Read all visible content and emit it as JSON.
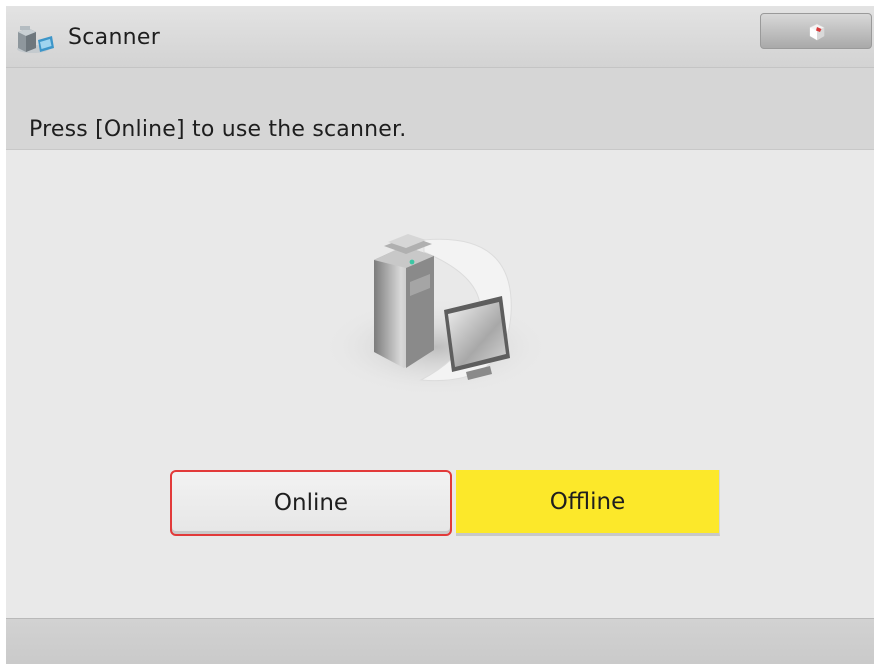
{
  "header": {
    "title": "Scanner",
    "app_icon": "scanner-icon",
    "corner_button_icon": "cube-icon"
  },
  "message": {
    "text": "Press [Online] to use the scanner."
  },
  "illustration": {
    "icon": "scanner-computer-icon"
  },
  "buttons": {
    "online_label": "Online",
    "offline_label": "Offline",
    "selected": "Online"
  },
  "colors": {
    "highlight_border": "#e23a3a",
    "offline_background": "#fce82a",
    "screen_background": "#e6e6e6"
  }
}
